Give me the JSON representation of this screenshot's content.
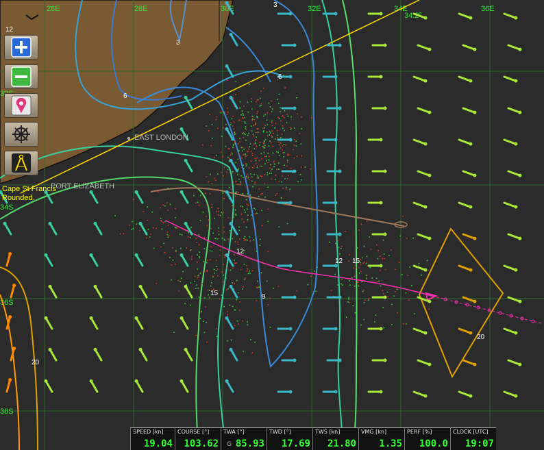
{
  "map": {
    "lon_labels": [
      "26E",
      "28E",
      "30E",
      "32E",
      "34E",
      "36E"
    ],
    "lat_labels": [
      "32S",
      "34S",
      "36S",
      "38S"
    ],
    "coord_readout": "34.2°",
    "places": [
      "EAST LONDON",
      "PORT ELIZABETH"
    ],
    "isotach_labels": [
      "3",
      "3",
      "12",
      "6",
      "6",
      "12",
      "12",
      "15",
      "15",
      "9",
      "20",
      "20"
    ],
    "colors": {
      "land": "#7a5a32",
      "sea": "#2b2b2b",
      "grid": "#2e6b2e",
      "route": "#ff2fb4",
      "track": "#a07a5a",
      "rhumb": "#ffd800",
      "zone": "#e0a000"
    }
  },
  "status": {
    "line1": "Cape St Francis",
    "line2": "Rounded."
  },
  "toolbar": [
    "zoom-in",
    "zoom-out",
    "locate",
    "helm",
    "compass"
  ],
  "instruments": [
    {
      "label": "SPEED [kn]",
      "value": "19.04",
      "mark": ""
    },
    {
      "label": "COURSE [°]",
      "value": "103.62",
      "mark": ""
    },
    {
      "label": "TWA [°]",
      "value": "85.93",
      "mark": "G"
    },
    {
      "label": "TWD [°]",
      "value": "17.69",
      "mark": ""
    },
    {
      "label": "TWS [kn]",
      "value": "21.80",
      "mark": ""
    },
    {
      "label": "VMG [kn]",
      "value": "1.35",
      "mark": ""
    },
    {
      "label": "PERF [%]",
      "value": "100.0",
      "mark": ""
    },
    {
      "label": "CLOCK [UTC]",
      "value": "19:07",
      "mark": ""
    }
  ]
}
